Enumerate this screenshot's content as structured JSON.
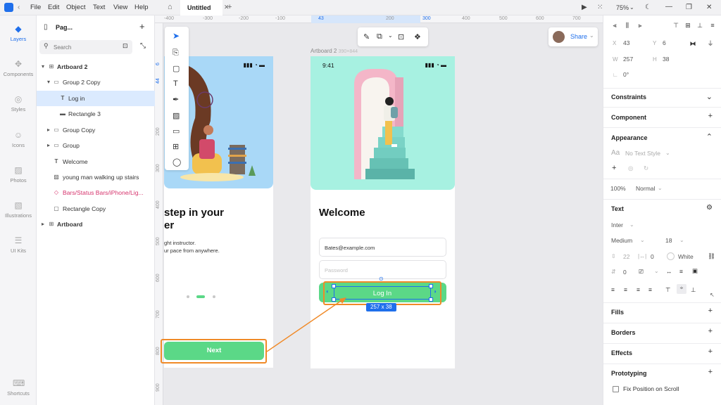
{
  "menu": {
    "file": "File",
    "edit": "Edit",
    "object": "Object",
    "text": "Text",
    "view": "View",
    "help": "Help"
  },
  "tab": {
    "title": "Untitled",
    "add": "+"
  },
  "zoom": "75%",
  "leftnav": {
    "layers": "Layers",
    "components": "Components",
    "styles": "Styles",
    "icons": "Icons",
    "photos": "Photos",
    "illustrations": "Illustrations",
    "uikits": "UI Kits",
    "shortcuts": "Shortcuts"
  },
  "layers": {
    "page": "Pag...",
    "search_placeholder": "Search",
    "items": [
      {
        "label": "Artboard 2"
      },
      {
        "label": "Group 2 Copy"
      },
      {
        "label": "Log in"
      },
      {
        "label": "Rectangle 3"
      },
      {
        "label": "Group Copy"
      },
      {
        "label": "Group"
      },
      {
        "label": "Welcome"
      },
      {
        "label": "young man walking up stairs"
      },
      {
        "label": "Bars/Status Bars/iPhone/Lig..."
      },
      {
        "label": "Rectangle Copy"
      },
      {
        "label": "Artboard"
      }
    ]
  },
  "ruler": {
    "top": [
      "-400",
      "-300",
      "-200",
      "-100",
      "43",
      "200",
      "300",
      "400",
      "500",
      "600",
      "700"
    ],
    "left": [
      "6",
      "44",
      "200",
      "300",
      "400",
      "500",
      "600",
      "700",
      "800",
      "900"
    ]
  },
  "canvas": {
    "artboard_label": "Artboard 2",
    "artboard_size": "390×844",
    "share": "Share",
    "time": "9:41",
    "welcome": "Welcome",
    "email": "Bates@example.com",
    "password": "Password",
    "login": "Log In",
    "dimension": "257 x 38",
    "left_heading_1": "step in your",
    "left_heading_2": "er",
    "left_text_1": "ght instructor.",
    "left_text_2": "ur pace from anywhere.",
    "next": "Next"
  },
  "props": {
    "x": "43",
    "y": "6",
    "w": "257",
    "h": "38",
    "rotation": "0°",
    "constraints": "Constraints",
    "component": "Component",
    "appearance": "Appearance",
    "text_style": "No Text Style",
    "opacity": "100%",
    "blend": "Normal",
    "text": "Text",
    "font": "Inter",
    "weight": "Medium",
    "size": "18",
    "line_height": "22",
    "letter_spacing": "0",
    "color_name": "White",
    "para": "0",
    "fills": "Fills",
    "borders": "Borders",
    "effects": "Effects",
    "prototyping": "Prototyping",
    "fix_position": "Fix Position on Scroll"
  },
  "colors": {
    "green": "#5bd887",
    "accent": "#1a73e8",
    "annotation": "#f08a28",
    "mint": "#a7f1e1",
    "sky": "#a9d8f7"
  }
}
